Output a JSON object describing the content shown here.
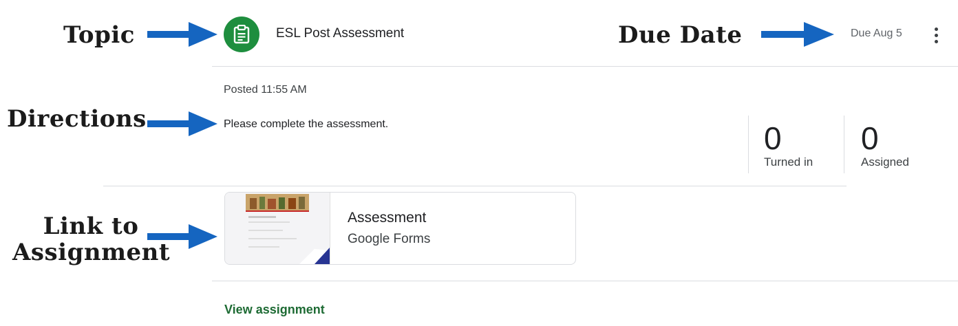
{
  "callouts": {
    "topic": "Topic",
    "due_date": "Due Date",
    "directions": "Directions",
    "link_line1": "Link to",
    "link_line2": "Assignment"
  },
  "header": {
    "icon": "assignment-clipboard-icon",
    "title": "ESL Post Assessment",
    "due": "Due Aug 5",
    "menu_icon": "more-vert-icon"
  },
  "body": {
    "posted": "Posted 11:55 AM",
    "instructions": "Please complete the assessment."
  },
  "stats": [
    {
      "value": "0",
      "label": "Turned in"
    },
    {
      "value": "0",
      "label": "Assigned"
    }
  ],
  "attachment": {
    "title": "Assessment",
    "type": "Google Forms"
  },
  "footer": {
    "view_link": "View assignment"
  },
  "colors": {
    "arrow": "#1565c0",
    "topic_icon_bg": "#1e8e3e",
    "link_green": "#1e6b34"
  }
}
